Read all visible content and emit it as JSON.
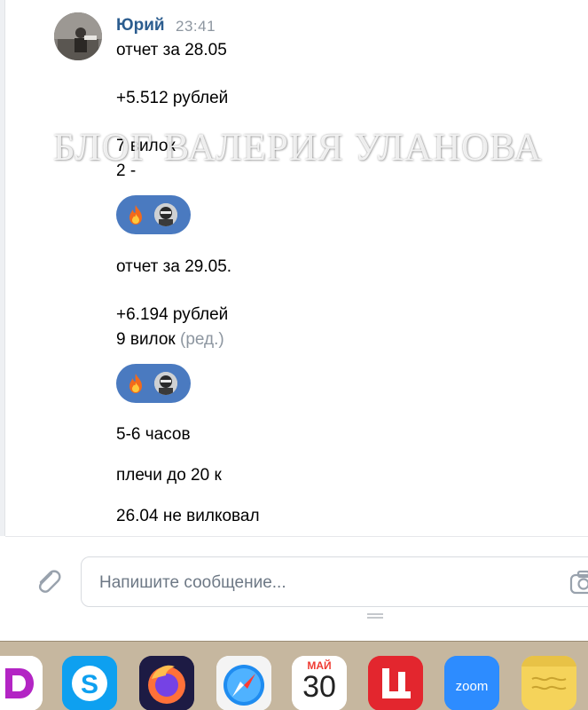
{
  "message": {
    "author": "Юрий",
    "time": "23:41",
    "lines": [
      "отчет за 28.05",
      "+5.512 рублей",
      "7 вилок",
      "2 -",
      "отчет за 29.05.",
      "+6.194 рублей",
      "9 вилок",
      "5-6 часов",
      "плечи до 20 к",
      "26.04 не вилковал"
    ],
    "edited_label": "(ред.)",
    "reactions": [
      {
        "icon": "fire-emoji-icon"
      },
      {
        "icon": "fire-emoji-icon"
      }
    ]
  },
  "watermark": "БЛОГ ВАЛЕРИЯ УЛАНОВА",
  "composer": {
    "placeholder": "Напишите сообщение..."
  },
  "dock": {
    "calendar_month": "МАЙ",
    "calendar_day": "30",
    "zoom_label": "zoom"
  },
  "colors": {
    "author": "#2c5d8f",
    "reaction_bg": "#4a7ac0",
    "dock_bg": "#c6b79f"
  }
}
